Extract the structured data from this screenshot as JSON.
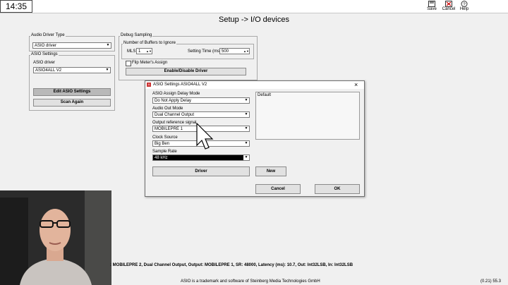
{
  "clock": "14:35",
  "page_title": "Setup -> I/O devices",
  "toolbar": {
    "save": "Save",
    "cancel": "Cancel",
    "help": "Help"
  },
  "audio_driver_type": {
    "label": "Audio Driver Type",
    "value": "ASIO driver"
  },
  "asio_settings": {
    "label": "ASIO Settings",
    "driver_label": "ASIO driver",
    "driver_value": "ASIO4ALL V2",
    "edit_button": "Edit ASIO Settings",
    "scan_button": "Scan Again"
  },
  "debug_sampling": {
    "label": "Debug Sampling",
    "buffers_group": "Number of Buffers to Ignore",
    "mls_label": "MLS",
    "mls_value": "1",
    "setting_time_label": "Setting Time (ms)",
    "setting_time_value": "500",
    "flip_checkbox_label": "Flip Meter's Assign",
    "enable_button": "Enable/Disable Driver"
  },
  "dialog": {
    "title": "ASIO Settings ASIO4ALL V2",
    "assign_delay_label": "ASIO Assign Delay Mode",
    "assign_delay_value": "Do Not Apply Delay",
    "audio_out_label": "Audio Out Mode",
    "audio_out_value": "Dual Channel Output",
    "output_ref_label": "Output reference signal",
    "output_ref_value": "MOBILEPRE 1",
    "clock_source_label": "Clock Source",
    "clock_source_value": "Big Ben",
    "sample_rate_label": "Sample Rate",
    "sample_rate_value": "48 kHz",
    "list_item": "Default",
    "driver_button": "Driver",
    "new_button": "New",
    "cancel_button": "Cancel",
    "ok_button": "OK"
  },
  "status_line": ": MOBILEPRE 2, Dual Channel Output, Output: MOBILEPRE 1, SR: 48000, Latency (ms): 10.7, Out: Int32LSB, In: Int32LSB",
  "trademark": "ASIO is a trademark and software of Steinberg Media Technologies GmbH",
  "version": "(0.21) 55.3",
  "colors": {
    "selection": "#000000",
    "button_face": "#e1e1e1",
    "dialog_border": "#6e6e6e"
  }
}
